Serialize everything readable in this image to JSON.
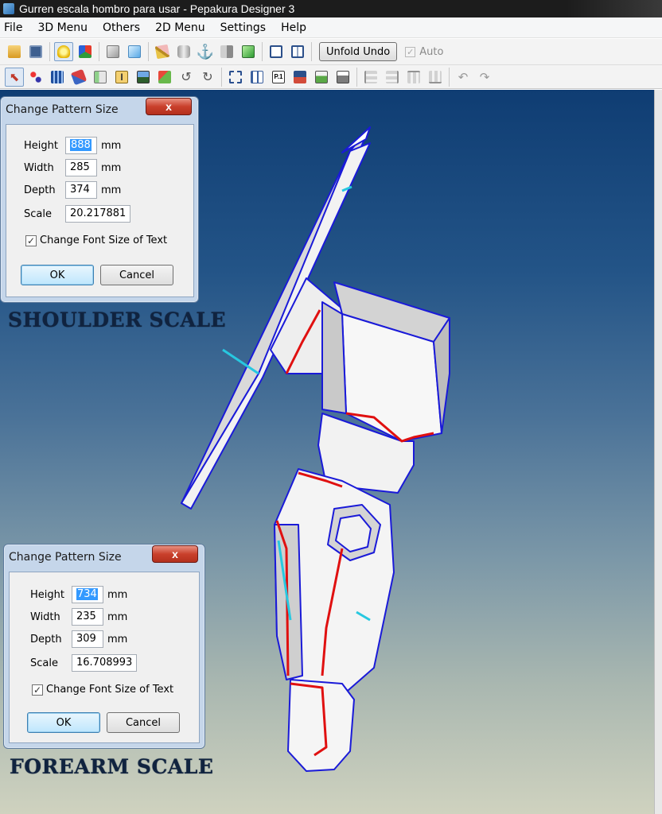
{
  "window": {
    "title": "Gurren escala hombro para usar - Pepakura Designer 3"
  },
  "menu": [
    "File",
    "3D Menu",
    "Others",
    "2D Menu",
    "Settings",
    "Help"
  ],
  "toolbar": {
    "unfold_undo": "Unfold Undo",
    "auto_label": "Auto",
    "auto_checked": true
  },
  "shoulder_dialog": {
    "title": "Change Pattern Size",
    "close": "x",
    "height_label": "Height",
    "height_value": "888",
    "width_label": "Width",
    "width_value": "285",
    "depth_label": "Depth",
    "depth_value": "374",
    "scale_label": "Scale",
    "scale_value": "20.217881",
    "unit": "mm",
    "font_checkbox": "Change Font Size of Text",
    "ok": "OK",
    "cancel": "Cancel"
  },
  "forearm_dialog": {
    "title": "Change Pattern Size",
    "close": "x",
    "height_label": "Height",
    "height_value": "734",
    "width_label": "Width",
    "width_value": "235",
    "depth_label": "Depth",
    "depth_value": "309",
    "scale_label": "Scale",
    "scale_value": "16.708993",
    "unit": "mm",
    "font_checkbox": "Change Font Size of Text",
    "ok": "OK",
    "cancel": "Cancel"
  },
  "captions": {
    "shoulder": "SHOULDER SCALE",
    "forearm": "FOREARM SCALE"
  },
  "colors": {
    "model_edge": "#1a1ad8",
    "cut_edge": "#e01010",
    "valley_edge": "#27c8e0",
    "viewport_top": "#0f3d73",
    "viewport_bottom": "#cfd2bf"
  }
}
